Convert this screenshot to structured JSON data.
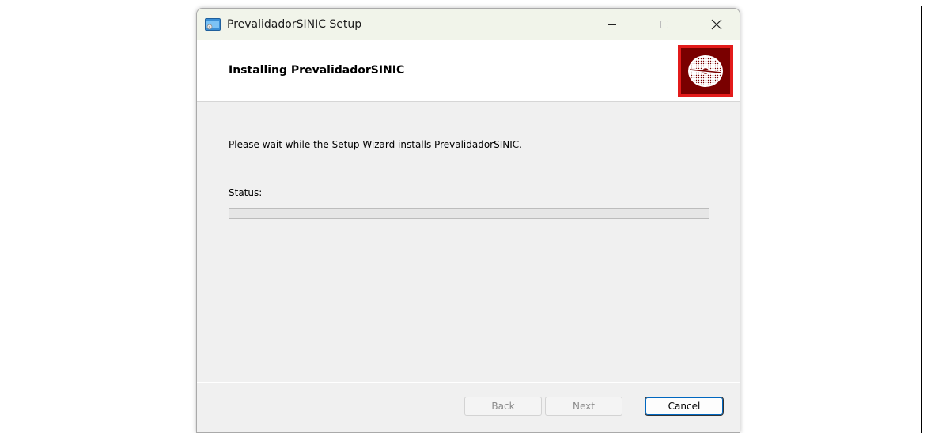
{
  "window": {
    "title": "PrevalidadorSINIC Setup"
  },
  "header": {
    "title": "Installing PrevalidadorSINIC"
  },
  "main": {
    "message": "Please wait while the Setup Wizard installs PrevalidadorSINIC.",
    "status_label": "Status:",
    "progress_fraction": 0
  },
  "buttons": {
    "back_label": "Back",
    "next_label": "Next",
    "cancel_label": "Cancel"
  },
  "colors": {
    "titlebar": "#f1f4ea",
    "logo_border": "#e31b1b",
    "logo_fill": "#7a0000",
    "progress_fill": "#06b025"
  }
}
